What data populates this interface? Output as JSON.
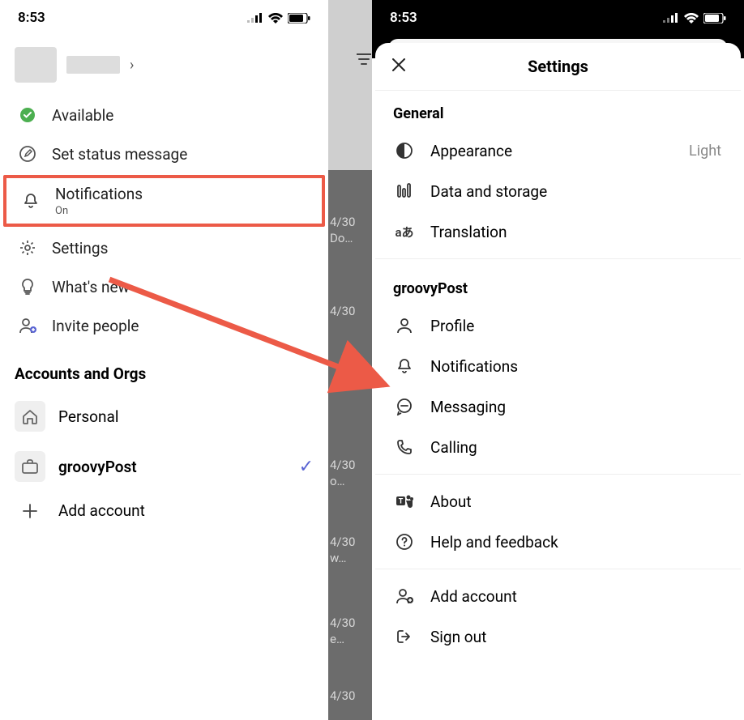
{
  "statusbar": {
    "time": "8:53"
  },
  "left": {
    "status": {
      "label": "Available"
    },
    "setStatus": {
      "label": "Set status message"
    },
    "notifications": {
      "label": "Notifications",
      "sub": "On"
    },
    "settings": {
      "label": "Settings"
    },
    "whatsNew": {
      "label": "What's new"
    },
    "invite": {
      "label": "Invite people"
    },
    "accountsHeader": "Accounts and Orgs",
    "personal": {
      "label": "Personal"
    },
    "org": {
      "label": "groovyPost"
    },
    "addAccount": {
      "label": "Add account"
    },
    "background": {
      "items": [
        {
          "date": "4/30",
          "text": "Do…"
        },
        {
          "date": "4/30",
          "text": ""
        },
        {
          "date": "4/30",
          "text": ""
        },
        {
          "date": "4/30",
          "text": "o…"
        },
        {
          "date": "4/30",
          "text": "w…"
        },
        {
          "date": "4/30",
          "text": "e…"
        },
        {
          "date": "4/30",
          "text": ""
        }
      ]
    }
  },
  "right": {
    "title": "Settings",
    "sections": {
      "general": {
        "label": "General"
      },
      "org": {
        "label": "groovyPost"
      }
    },
    "appearance": {
      "label": "Appearance",
      "value": "Light"
    },
    "dataStorage": {
      "label": "Data and storage"
    },
    "translation": {
      "label": "Translation"
    },
    "profile": {
      "label": "Profile"
    },
    "notifications": {
      "label": "Notifications"
    },
    "messaging": {
      "label": "Messaging"
    },
    "calling": {
      "label": "Calling"
    },
    "about": {
      "label": "About"
    },
    "help": {
      "label": "Help and feedback"
    },
    "addAccount": {
      "label": "Add account"
    },
    "signOut": {
      "label": "Sign out"
    }
  }
}
